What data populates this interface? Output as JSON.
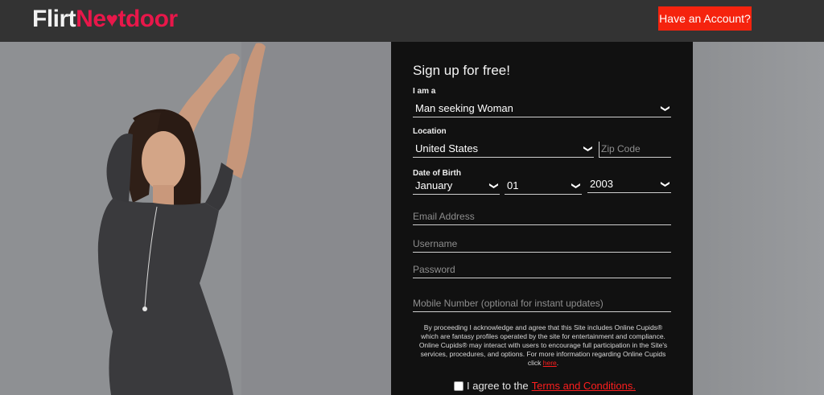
{
  "header": {
    "logo_part1": "Flirt",
    "logo_part2": "Ne",
    "logo_heart": "♥",
    "logo_part3": "tdoor",
    "account_button": "Have an Account?"
  },
  "form": {
    "title": "Sign up for free!",
    "i_am_label": "I am a",
    "i_am_value": "Man seeking Woman",
    "location_label": "Location",
    "country_value": "United States",
    "zip_placeholder": "Zip Code",
    "dob_label": "Date of Birth",
    "dob_month": "January",
    "dob_day": "01",
    "dob_year": "2003",
    "email_placeholder": "Email Address",
    "username_placeholder": "Username",
    "password_placeholder": "Password",
    "mobile_placeholder": "Mobile Number (optional for instant updates)",
    "legal_text": "By proceeding I acknowledge and agree that this Site includes Online Cupids® which are fantasy profiles operated by the site for entertainment and compliance. Online Cupids® may interact with users to encourage full participation in the Site's services, procedures, and options. For more information regarding Online Cupids click",
    "legal_link": "here",
    "legal_end": ".",
    "agree_text": "I agree to the",
    "terms_link": "Terms and Conditions."
  },
  "colors": {
    "brand_pink": "#e8174a",
    "accent_red": "#f5230e",
    "panel_bg": "#111111"
  },
  "icons": {
    "dropdown": "chevron-down-icon"
  }
}
